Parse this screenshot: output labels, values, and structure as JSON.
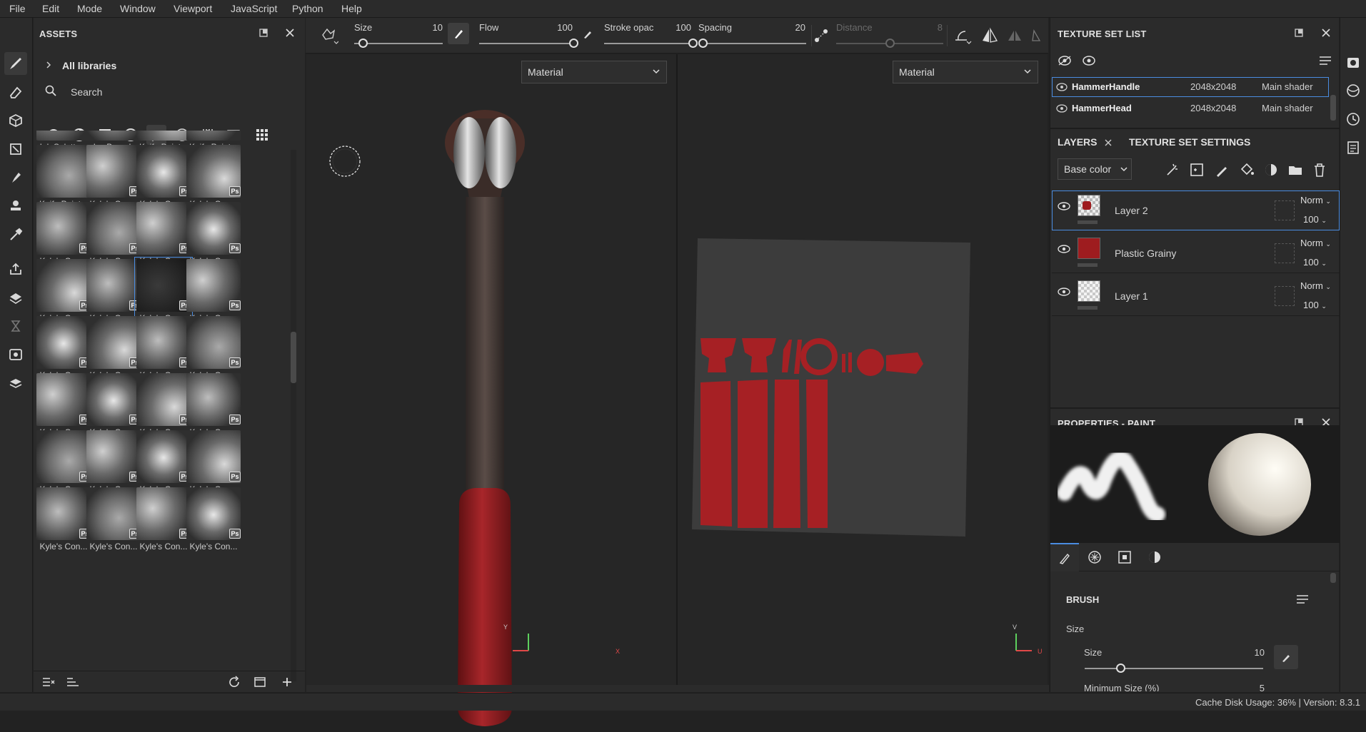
{
  "menu": [
    "File",
    "Edit",
    "Mode",
    "Window",
    "Viewport",
    "JavaScript",
    "Python",
    "Help"
  ],
  "assets": {
    "title": "ASSETS",
    "breadcrumb": "All libraries",
    "search_placeholder": "Search",
    "tiles": [
      {
        "label": "Ink Splatte...",
        "ps": false
      },
      {
        "label": "Ivy Branch",
        "ps": false
      },
      {
        "label": "Knife Paint...",
        "ps": false
      },
      {
        "label": "Knife Paint...",
        "ps": false
      },
      {
        "label": "Knife Paint...",
        "ps": false
      },
      {
        "label": "Kyle's Con...",
        "ps": true
      },
      {
        "label": "Kyle's Con...",
        "ps": true
      },
      {
        "label": "Kyle's Con...",
        "ps": true
      },
      {
        "label": "Kyle's Con...",
        "ps": true
      },
      {
        "label": "Kyle's Con...",
        "ps": true
      },
      {
        "label": "Kyle's Con...",
        "ps": true
      },
      {
        "label": "Kyle's Con...",
        "ps": true
      },
      {
        "label": "Kyle's Con...",
        "ps": true
      },
      {
        "label": "Kyle's Con...",
        "ps": true
      },
      {
        "label": "Kyle's Con...",
        "ps": true,
        "selected": true
      },
      {
        "label": "Kyle's Con...",
        "ps": true
      },
      {
        "label": "Kyle's Con...",
        "ps": true
      },
      {
        "label": "Kyle's Con...",
        "ps": true
      },
      {
        "label": "Kyle's Con...",
        "ps": true
      },
      {
        "label": "Kyle's Con...",
        "ps": true
      },
      {
        "label": "Kyle's Con...",
        "ps": true
      },
      {
        "label": "Kyle's Con...",
        "ps": true
      },
      {
        "label": "Kyle's Con...",
        "ps": true
      },
      {
        "label": "Kyle's Con...",
        "ps": true
      },
      {
        "label": "Kyle's Con...",
        "ps": true
      },
      {
        "label": "Kyle's Con...",
        "ps": true
      },
      {
        "label": "Kyle's Con...",
        "ps": true
      },
      {
        "label": "Kyle's Con...",
        "ps": true
      },
      {
        "label": "Kyle's Con...",
        "ps": true
      },
      {
        "label": "Kyle's Con...",
        "ps": true
      },
      {
        "label": "Kyle's Con...",
        "ps": true
      },
      {
        "label": "Kyle's Con...",
        "ps": true
      }
    ],
    "ps_badge": "Ps"
  },
  "toolbar": {
    "size_label": "Size",
    "size_value": "10",
    "size_fraction": 0.1,
    "flow_label": "Flow",
    "flow_value": "100",
    "flow_fraction": 1.0,
    "stroke_label": "Stroke opac",
    "stroke_value": "100",
    "stroke_fraction": 1.0,
    "spacing_label": "Spacing",
    "spacing_value": "20",
    "spacing_fraction": 0.03,
    "distance_label": "Distance",
    "distance_value": "8",
    "distance_fraction": 0.5
  },
  "viewports": {
    "left_channel": "Material",
    "right_channel": "Material",
    "axis_3d": {
      "y": "Y",
      "x": "X"
    },
    "axis_2d": {
      "v": "V",
      "u": "U"
    }
  },
  "texture_set_list": {
    "title": "TEXTURE SET LIST",
    "rows": [
      {
        "name": "HammerHandle",
        "resolution": "2048x2048",
        "shader": "Main shader",
        "selected": true
      },
      {
        "name": "HammerHead",
        "resolution": "2048x2048",
        "shader": "Main shader",
        "selected": false
      }
    ]
  },
  "layers_panel": {
    "tab_layers": "LAYERS",
    "tab_settings": "TEXTURE SET SETTINGS",
    "channel": "Base color",
    "layers": [
      {
        "name": "Layer 2",
        "blend": "Norm",
        "opacity": "100",
        "selected": true,
        "thumb": "checker-red"
      },
      {
        "name": "Plastic Grainy",
        "blend": "Norm",
        "opacity": "100",
        "selected": false,
        "thumb": "red"
      },
      {
        "name": "Layer 1",
        "blend": "Norm",
        "opacity": "100",
        "selected": false,
        "thumb": "checker"
      }
    ]
  },
  "properties": {
    "title": "PROPERTIES - PAINT",
    "section": "BRUSH",
    "group": "Size",
    "size_label": "Size",
    "size_value": "10",
    "size_fraction": 0.2,
    "min_size_label": "Minimum Size (%)",
    "min_size_value": "5"
  },
  "status": {
    "text": "Cache Disk Usage:  36% | Version: 8.3.1"
  },
  "colors": {
    "accent": "#4a8ce0",
    "panel": "#2b2b2b",
    "viewport": "#262626",
    "handle_red": "#9e1c1f"
  }
}
